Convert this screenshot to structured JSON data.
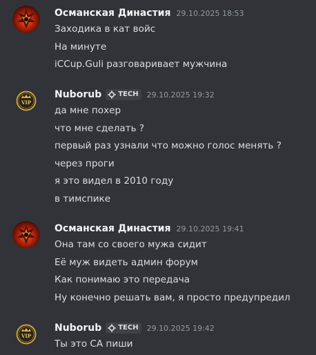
{
  "messages": [
    {
      "author": "Османская Династия",
      "timestamp": "29.10.2025 18:53",
      "avatar_icon": "ottoman-emblem-icon",
      "lines": [
        "Заходика в кат войс",
        "На минуте",
        "iCCup.Guli разговаривает мужчина"
      ]
    },
    {
      "author": "Nuborub",
      "tag_label": "TECH",
      "tag_icon": "gear-badge-icon",
      "timestamp": "29.10.2025 19:32",
      "avatar_icon": "vip-badge-icon",
      "lines": [
        "да мне похер",
        "что мне сделать ?",
        "первый раз узнали что можно голос менять ?",
        "через проги",
        "я это видел в 2010 году",
        "в тимспике"
      ]
    },
    {
      "author": "Османская Династия",
      "timestamp": "29.10.2025 19:41",
      "avatar_icon": "ottoman-emblem-icon",
      "lines": [
        "Она там со своего мужа сидит",
        "Её муж видеть админ форум",
        "Как понимаю это передача",
        "Ну конечно решать вам, я просто предупредил"
      ]
    },
    {
      "author": "Nuborub",
      "tag_label": "TECH",
      "tag_icon": "gear-badge-icon",
      "timestamp": "29.10.2025 19:42",
      "avatar_icon": "vip-badge-icon",
      "lines": [
        "Ты это СА пиши"
      ]
    }
  ],
  "colors": {
    "background": "#313338",
    "username": "#f2f3f5",
    "text": "#dbdee1",
    "timestamp": "#949ba4",
    "tag_background": "#3f4147"
  }
}
